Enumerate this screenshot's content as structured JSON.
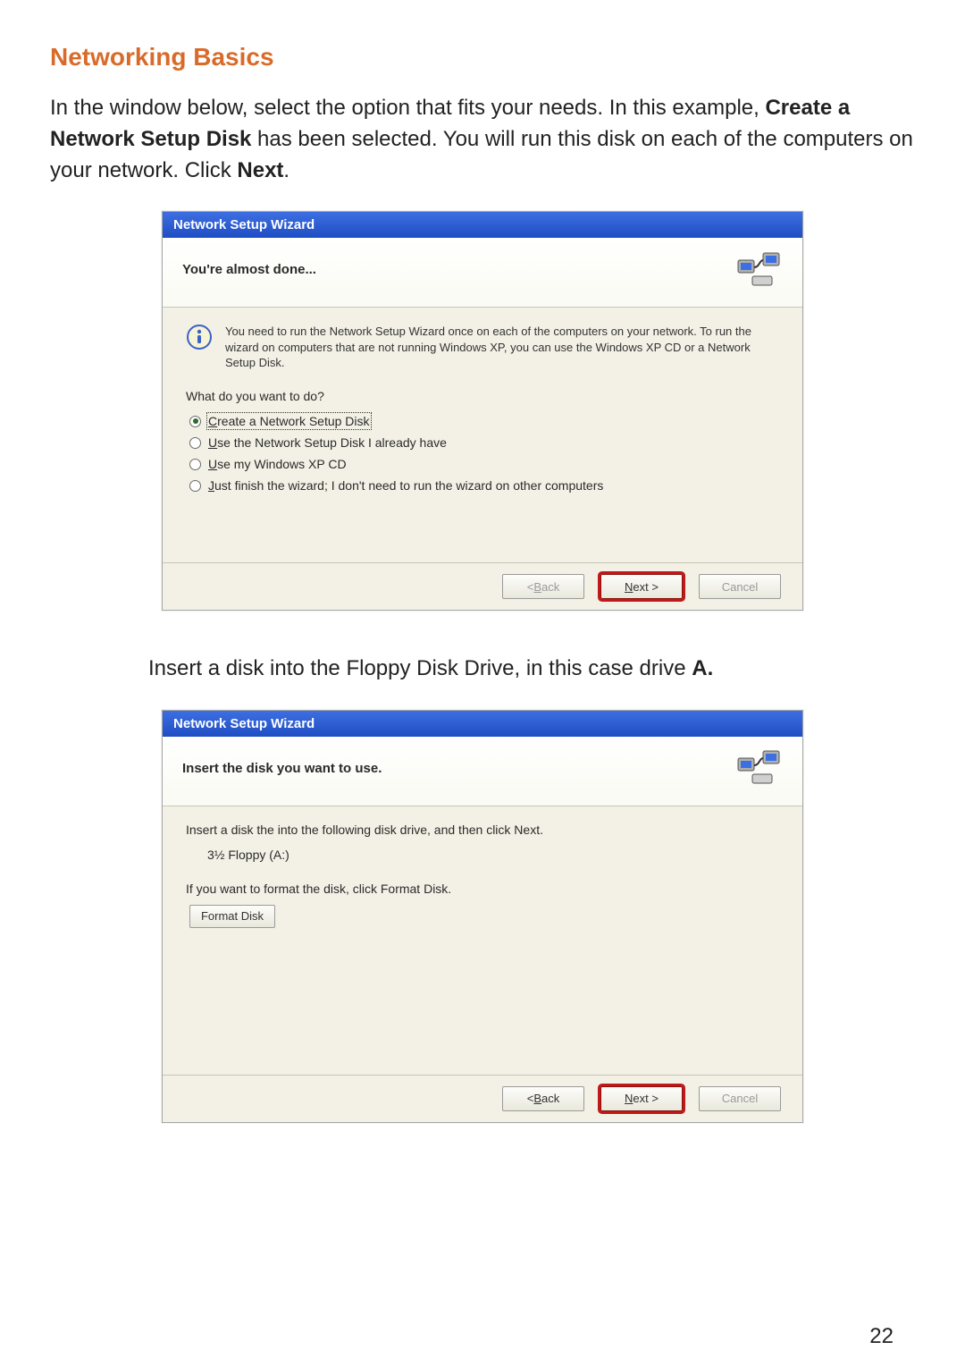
{
  "section_title": "Networking Basics",
  "intro": {
    "before_bold1": "In the window below, select the option that fits your needs.  In this example, ",
    "bold1": "Create a Network Setup Disk",
    "mid": " has been selected.  You will run this disk on each of the computers on your network.  Click ",
    "bold2": "Next",
    "after": "."
  },
  "wizard1": {
    "title": "Network Setup Wizard",
    "heading": "You're almost done...",
    "info_text": "You need to run the Network Setup Wizard once on each of the computers on your network. To run the wizard on computers that are not running Windows XP, you can use the Windows XP CD or a Network Setup Disk.",
    "question": "What do you want to do?",
    "options": {
      "create_pre": "C",
      "create_post": "reate a Network Setup Disk",
      "use_disk_pre": "U",
      "use_disk_post": "se the Network Setup Disk I already have",
      "use_cd_pre1": "U",
      "use_cd_mid": "se my Windows XP CD",
      "just_finish_pre": "J",
      "just_finish_post": "ust finish the wizard; I don't need to run the wizard on other computers"
    },
    "buttons": {
      "back": "< Back",
      "next_pre": "N",
      "next_post": "ext >",
      "cancel": "Cancel"
    }
  },
  "mid_instruction": {
    "before": "Insert a disk into the Floppy Disk Drive, in this case drive ",
    "bold": "A.",
    "after": ""
  },
  "wizard2": {
    "title": "Network Setup Wizard",
    "heading": "Insert the disk you want to use.",
    "insert_text": "Insert a disk the into the following disk drive, and then click Next.",
    "drive": "3½ Floppy (A:)",
    "format_text": "If you want to format the disk, click Format Disk.",
    "format_btn_pre": "F",
    "format_btn_post": "ormat Disk",
    "buttons": {
      "back_pre": "B",
      "back_post": "ack",
      "next_pre": "N",
      "next_post": "ext >",
      "cancel": "Cancel"
    }
  },
  "page_number": "22",
  "colors": {
    "accent_orange": "#d96b2a",
    "xp_blue1": "#3d6fe2",
    "xp_blue2": "#1f4dc3",
    "highlight_red": "#c11818"
  }
}
